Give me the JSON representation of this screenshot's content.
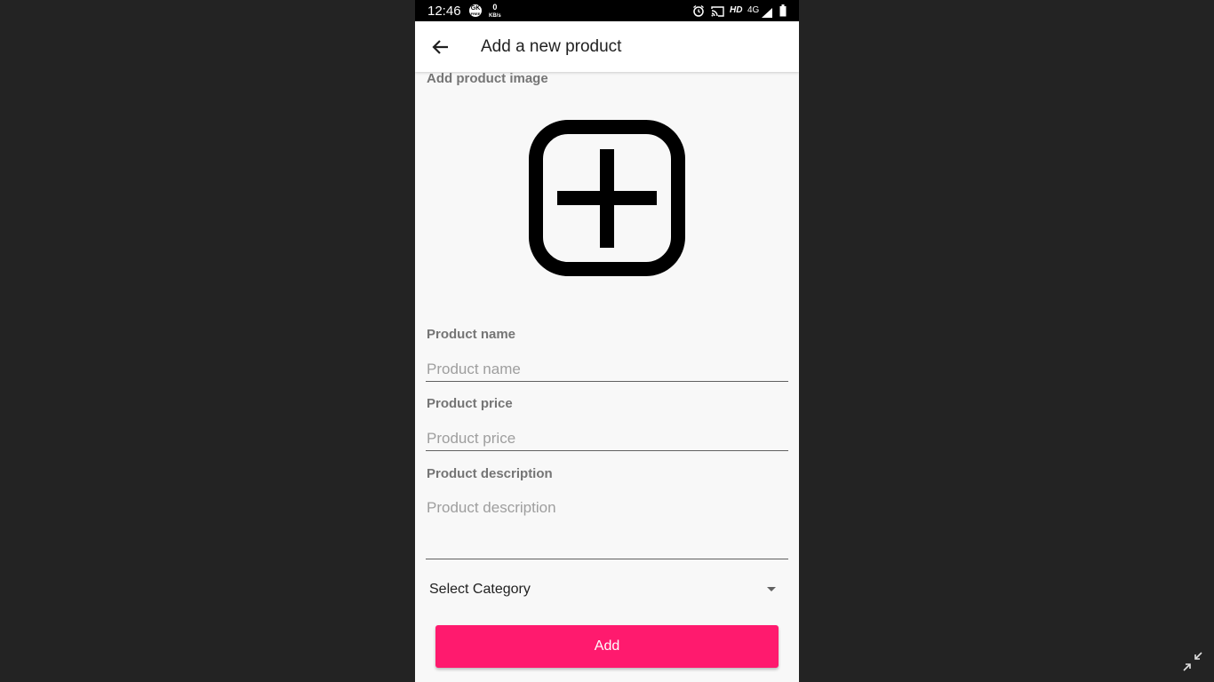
{
  "status_bar": {
    "time": "12:46",
    "data_icon_top": "GK",
    "data_icon_bottom": "FREE",
    "speed_value": "0",
    "speed_unit": "KB/s",
    "network_hd": "HD",
    "network_type": "4G",
    "icons": [
      "alarm-icon",
      "cast-icon",
      "signal-icon",
      "battery-icon"
    ]
  },
  "app_bar": {
    "title": "Add a new product",
    "back_icon": "arrow-back-icon"
  },
  "form": {
    "image_label": "Add product image",
    "image_icon": "add-box-icon",
    "name_label": "Product name",
    "name_placeholder": "Product name",
    "name_value": "",
    "price_label": "Product price",
    "price_placeholder": "Product price",
    "price_value": "",
    "description_label": "Product description",
    "description_placeholder": "Product description",
    "description_value": "",
    "category_selected": "Select Category",
    "submit_label": "Add"
  },
  "colors": {
    "accent": "#ff1a6e",
    "background": "#f8f8f8",
    "outer_background": "#232323"
  }
}
